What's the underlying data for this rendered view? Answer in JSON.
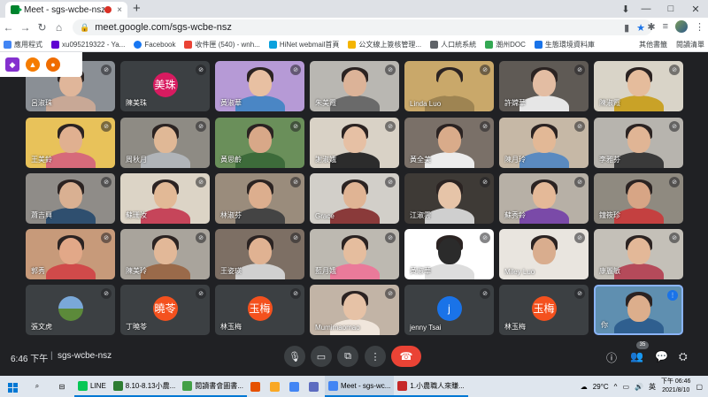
{
  "browser": {
    "tab_title": "Meet - sgs-wcbe-nsz",
    "tab_close": "×",
    "new_tab": "+",
    "window_controls": [
      "—",
      "□",
      "✕"
    ],
    "url": "meet.google.com/sgs-wcbe-nsz",
    "bookmarks": [
      {
        "label": "應用程式",
        "color": "#4285f4"
      },
      {
        "label": "xu095219322 - Ya...",
        "color": "#6001d2"
      },
      {
        "label": "Facebook",
        "color": "#1877f2"
      },
      {
        "label": "收件匣 (540) - wnh...",
        "color": "#ea4335"
      },
      {
        "label": "HiNet webmail首頁",
        "color": "#0aa1dd"
      },
      {
        "label": "公文線上簽核管理...",
        "color": "#f4b400"
      },
      {
        "label": "人口統系統",
        "color": "#5f6368"
      },
      {
        "label": "潮州DOC",
        "color": "#34a853"
      },
      {
        "label": "生態環境資料庫",
        "color": "#1a73e8"
      }
    ],
    "bookmarks_right": [
      "其他書籤",
      "閱讀清單"
    ]
  },
  "meet": {
    "participants": [
      {
        "name": "呂淑珠",
        "type": "video",
        "bg": "#8a8f95",
        "skin": "#e0b69a",
        "shirt": "#c8a896"
      },
      {
        "name": "陳美珠",
        "type": "avatar",
        "initials": "美珠",
        "avatar_color": "#d81b60"
      },
      {
        "name": "黃淑華",
        "type": "video",
        "bg": "#b69ad6",
        "skin": "#e8c0a2",
        "shirt": "#4a86c5"
      },
      {
        "name": "朱美霞",
        "type": "video",
        "bg": "#b9b7b2",
        "skin": "#dcb398",
        "shirt": "#6a6a6a"
      },
      {
        "name": "Linda Luo",
        "type": "video",
        "bg": "#c9a86a",
        "skin": "#c9a86a",
        "shirt": "#9e8452"
      },
      {
        "name": "許嫦華",
        "type": "video",
        "bg": "#5f5a55",
        "skin": "#e3bda3",
        "shirt": "#e6e6e6"
      },
      {
        "name": "陳淑霞",
        "type": "video",
        "bg": "#d9d4c8",
        "skin": "#e5bc9c",
        "shirt": "#c9a227"
      },
      {
        "name": "王美鈴",
        "type": "video",
        "bg": "#e8c25a",
        "skin": "#e0b090",
        "shirt": "#d66a7a"
      },
      {
        "name": "周秋月",
        "type": "video",
        "bg": "#8e8b84",
        "skin": "#e0b896",
        "shirt": "#b0b4b8"
      },
      {
        "name": "黃思齡",
        "type": "video",
        "bg": "#6a8f5a",
        "skin": "#d8a888",
        "shirt": "#3d6b3a"
      },
      {
        "name": "謝淑娥",
        "type": "video",
        "bg": "#d9d2c6",
        "skin": "#e6c0a4",
        "shirt": "#2c2c2c"
      },
      {
        "name": "黃全美",
        "type": "video",
        "bg": "#7a7068",
        "skin": "#d9ab8a",
        "shirt": "#ececec"
      },
      {
        "name": "陳月玲",
        "type": "video",
        "bg": "#c6b8a6",
        "skin": "#e2b896",
        "shirt": "#5a8ac0"
      },
      {
        "name": "李雅芬",
        "type": "video",
        "bg": "#b7b4ae",
        "skin": "#e0b595",
        "shirt": "#3a3a3a"
      },
      {
        "name": "蕭吉興",
        "type": "video",
        "bg": "#8f8c88",
        "skin": "#d9b092",
        "shirt": "#2f4f6f"
      },
      {
        "name": "蘇珊汝",
        "type": "video",
        "bg": "#dcd4c6",
        "skin": "#e2b996",
        "shirt": "#c6455a"
      },
      {
        "name": "林淑芬",
        "type": "video",
        "bg": "#9a8c7c",
        "skin": "#dcae8e",
        "shirt": "#444444"
      },
      {
        "name": "Grace",
        "type": "video",
        "bg": "#d2cfc9",
        "skin": "#e0b494",
        "shirt": "#8a3a3a"
      },
      {
        "name": "江淑雲",
        "type": "video",
        "bg": "#3e3a36",
        "skin": "#e6c4a8",
        "shirt": "#cfcfcf"
      },
      {
        "name": "蘇秀鈴",
        "type": "video",
        "bg": "#b7b0a6",
        "skin": "#e4b998",
        "shirt": "#7a4aa8"
      },
      {
        "name": "鐘筱珍",
        "type": "video",
        "bg": "#8f8a80",
        "skin": "#d7a585",
        "shirt": "#c44040"
      },
      {
        "name": "郭秀",
        "type": "video",
        "bg": "#c79a7a",
        "skin": "#e2a888",
        "shirt": "#d04a4a"
      },
      {
        "name": "陳美玲",
        "type": "video",
        "bg": "#a9a49c",
        "skin": "#e2b898",
        "shirt": "#9a6a4a"
      },
      {
        "name": "王姿瑛",
        "type": "video",
        "bg": "#7d6f64",
        "skin": "#e0b292",
        "shirt": "#d0d0d0"
      },
      {
        "name": "藍月娥",
        "type": "video",
        "bg": "#bdb9b1",
        "skin": "#e5bd9e",
        "shirt": "#ea7a9a"
      },
      {
        "name": "黃淑華",
        "type": "video",
        "bg": "#ffffff",
        "skin": "#2b2b2b",
        "shirt": "#dddddd"
      },
      {
        "name": "Miley Luo",
        "type": "video",
        "bg": "#e9e5df",
        "skin": "#d9ad8e",
        "shirt": "#e9e5df"
      },
      {
        "name": "康麗敏",
        "type": "video",
        "bg": "#c4c0b8",
        "skin": "#e3b898",
        "shirt": "#b54a5a"
      },
      {
        "name": "張文虎",
        "type": "avatar-image",
        "avatar_color": "#4a7cb0"
      },
      {
        "name": "丁曉苓",
        "type": "avatar",
        "initials": "曉苓",
        "avatar_color": "#f4511e"
      },
      {
        "name": "林玉梅",
        "type": "avatar",
        "initials": "玉梅",
        "avatar_color": "#f4511e"
      },
      {
        "name": "Mumimaomao",
        "type": "video",
        "bg": "#c2b4a6",
        "skin": "#e6c2a6",
        "shirt": "#f0e6dc"
      },
      {
        "name": "jenny Tsai",
        "type": "avatar",
        "initials": "j",
        "avatar_color": "#1a73e8"
      },
      {
        "name": "林玉梅",
        "type": "avatar",
        "initials": "玉梅",
        "avatar_color": "#f4511e"
      },
      {
        "name": "你",
        "type": "video",
        "bg": "#5f8fb0",
        "skin": "#dcae8c",
        "shirt": "#2f5f8f",
        "active": true
      }
    ],
    "clock": "6:46 下午",
    "separator": "|",
    "meeting_code": "sgs-wcbe-nsz",
    "participant_count": "35"
  },
  "taskbar": {
    "items": [
      {
        "label": "LINE",
        "color": "#06c755",
        "state": "open"
      },
      {
        "label": "8.10-8.13小農...",
        "color": "#2e7d32",
        "state": "open"
      },
      {
        "label": "閱讀書會圖書...",
        "color": "#43a047",
        "state": "open"
      },
      {
        "label": "",
        "color": "#e65100",
        "state": "none"
      },
      {
        "label": "",
        "color": "#f9a825",
        "state": "none"
      },
      {
        "label": "",
        "color": "#4285f4",
        "state": "none"
      },
      {
        "label": "",
        "color": "#5c6bc0",
        "state": "none"
      },
      {
        "label": "Meet - sgs-wc...",
        "color": "#4285f4",
        "state": "active"
      },
      {
        "label": "1.小農職人來賺...",
        "color": "#c62828",
        "state": "open"
      }
    ],
    "weather": "29°C",
    "ime": "英",
    "time": "下午 06:46",
    "date": "2021/8/10"
  }
}
